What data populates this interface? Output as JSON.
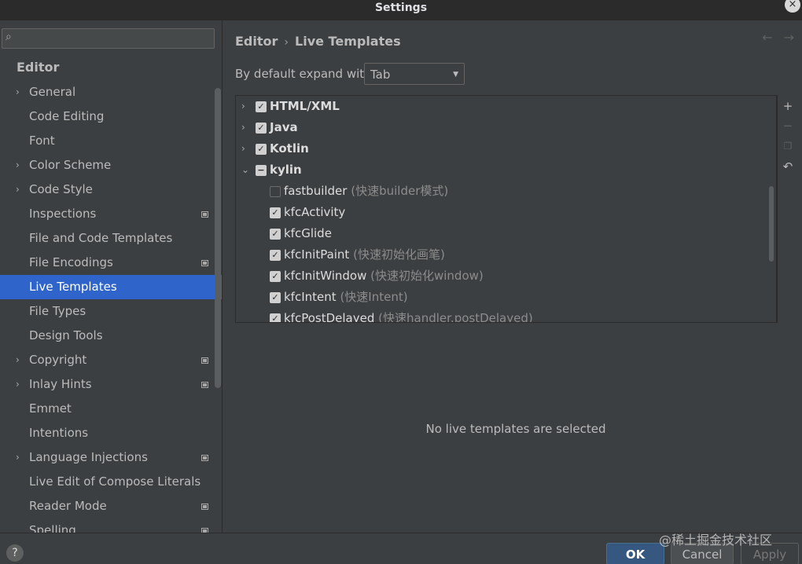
{
  "window": {
    "title": "Settings",
    "close_label": "×"
  },
  "sidebar": {
    "search_placeholder": "",
    "section": "Editor",
    "items": [
      {
        "label": "General",
        "expandable": true,
        "project": false
      },
      {
        "label": "Code Editing",
        "expandable": false,
        "project": false
      },
      {
        "label": "Font",
        "expandable": false,
        "project": false
      },
      {
        "label": "Color Scheme",
        "expandable": true,
        "project": false
      },
      {
        "label": "Code Style",
        "expandable": true,
        "project": false
      },
      {
        "label": "Inspections",
        "expandable": false,
        "project": true
      },
      {
        "label": "File and Code Templates",
        "expandable": false,
        "project": false
      },
      {
        "label": "File Encodings",
        "expandable": false,
        "project": true
      },
      {
        "label": "Live Templates",
        "expandable": false,
        "project": false,
        "selected": true
      },
      {
        "label": "File Types",
        "expandable": false,
        "project": false
      },
      {
        "label": "Design Tools",
        "expandable": false,
        "project": false
      },
      {
        "label": "Copyright",
        "expandable": true,
        "project": true
      },
      {
        "label": "Inlay Hints",
        "expandable": true,
        "project": true
      },
      {
        "label": "Emmet",
        "expandable": false,
        "project": false
      },
      {
        "label": "Intentions",
        "expandable": false,
        "project": false
      },
      {
        "label": "Language Injections",
        "expandable": true,
        "project": true
      },
      {
        "label": "Live Edit of Compose Literals",
        "expandable": false,
        "project": false
      },
      {
        "label": "Reader Mode",
        "expandable": false,
        "project": true
      },
      {
        "label": "Spelling",
        "expandable": false,
        "project": true
      }
    ]
  },
  "main": {
    "breadcrumb": [
      "Editor",
      "Live Templates"
    ],
    "expand_label": "By default expand with",
    "expand_value": "Tab",
    "groups": [
      {
        "name": "HTML/XML",
        "checked": "checked",
        "expanded": false
      },
      {
        "name": "Java",
        "checked": "checked",
        "expanded": false
      },
      {
        "name": "Kotlin",
        "checked": "checked",
        "expanded": false
      },
      {
        "name": "kylin",
        "checked": "partial",
        "expanded": true
      }
    ],
    "templates": [
      {
        "name": "fastbuilder",
        "desc": "(快速builder模式)",
        "checked": false
      },
      {
        "name": "kfcActivity",
        "desc": "",
        "checked": true
      },
      {
        "name": "kfcGlide",
        "desc": "",
        "checked": true
      },
      {
        "name": "kfcInitPaint",
        "desc": "(快速初始化画笔)",
        "checked": true
      },
      {
        "name": "kfcInitWindow",
        "desc": "(快速初始化window)",
        "checked": true
      },
      {
        "name": "kfcIntent",
        "desc": "(快速Intent)",
        "checked": true
      },
      {
        "name": "kfcPostDelayed",
        "desc": "(快速handler.postDelayed)",
        "checked": true
      }
    ],
    "empty_message": "No live templates are selected"
  },
  "footer": {
    "help_label": "?",
    "ok_label": "OK",
    "cancel_label": "Cancel",
    "apply_label": "Apply",
    "watermark": "@稀土掘金技术社区"
  }
}
